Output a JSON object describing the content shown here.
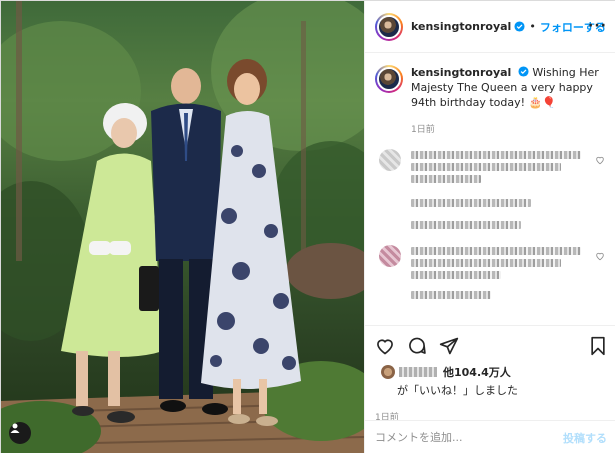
{
  "post": {
    "username": "kensingtonroyal",
    "follow_label": "フォローする",
    "more_icon": "ellipsis-icon",
    "caption": {
      "username": "kensingtonroyal",
      "text": "Wishing Her Majesty The Queen a very happy 94th birthday today! 🎂🎈",
      "time": "1日前"
    },
    "likes": {
      "count_label": "他104.4万人",
      "suffix": "が「いいね！」しました"
    },
    "post_time": "1日前",
    "comment_box": {
      "placeholder": "コメントを追加...",
      "post_label": "投稿する"
    }
  },
  "colors": {
    "accent": "#0095f6",
    "post_disabled": "#b2dffc",
    "muted": "#8e8e8e",
    "text": "#262626",
    "divider": "#efefef"
  },
  "icons": {
    "verified": "verified-badge-icon",
    "like": "heart-icon",
    "comment": "comment-bubble-icon",
    "share": "paper-plane-icon",
    "save": "bookmark-icon",
    "tagged_user": "user-tag-icon"
  }
}
